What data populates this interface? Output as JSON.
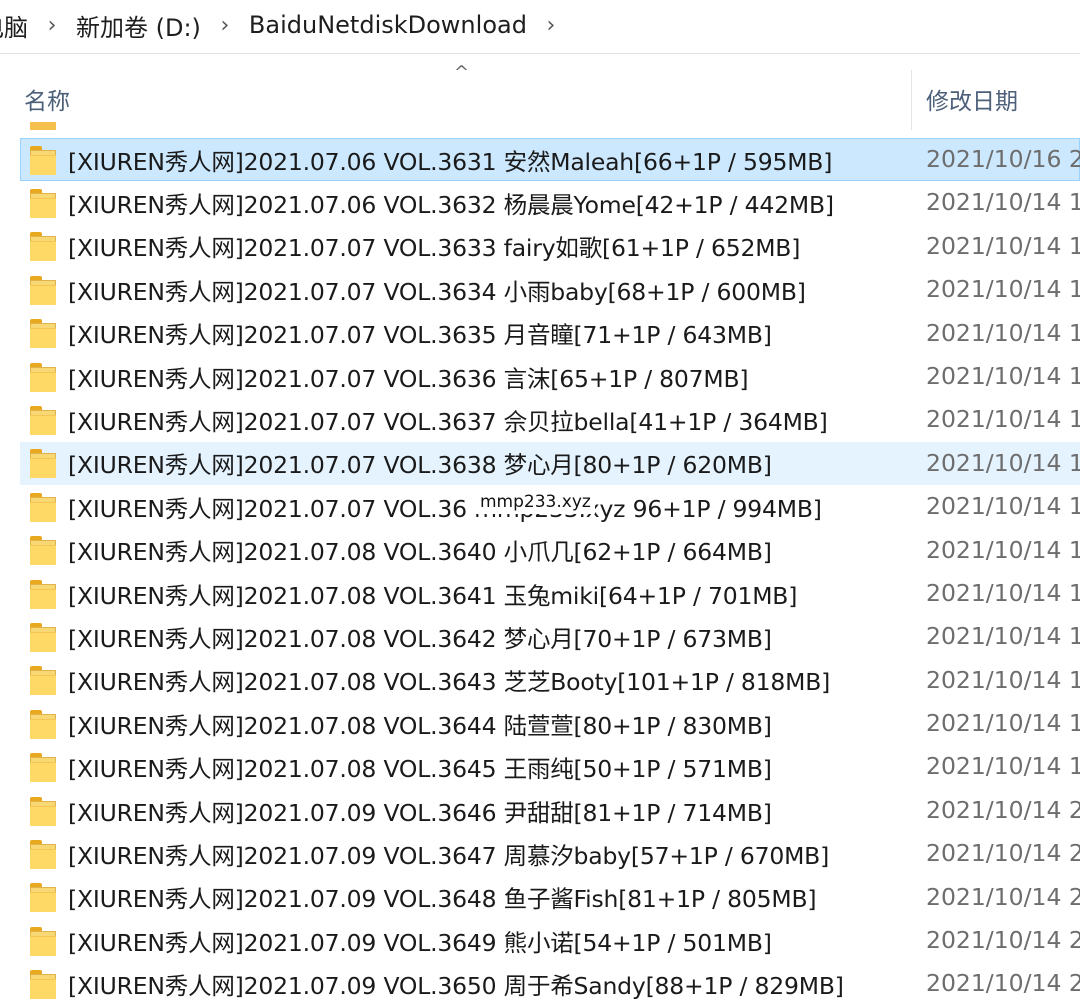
{
  "breadcrumb": {
    "items": [
      "电脑",
      "新加卷 (D:)",
      "BaiduNetdiskDownload"
    ],
    "separator": "›"
  },
  "columns": {
    "name": "名称",
    "date_modified": "修改日期",
    "sort_indicator": "^"
  },
  "files": [
    {
      "name": "[XIUREN秀人网]2021.07.06 VOL.3631 安然Maleah[66+1P / 595MB]",
      "date": "2021/10/16 2",
      "state": "selected"
    },
    {
      "name": "[XIUREN秀人网]2021.07.06 VOL.3632 杨晨晨Yome[42+1P / 442MB]",
      "date": "2021/10/14 1",
      "state": ""
    },
    {
      "name": "[XIUREN秀人网]2021.07.07 VOL.3633 fairy如歌[61+1P / 652MB]",
      "date": "2021/10/14 1",
      "state": ""
    },
    {
      "name": "[XIUREN秀人网]2021.07.07 VOL.3634 小雨baby[68+1P / 600MB]",
      "date": "2021/10/14 1",
      "state": ""
    },
    {
      "name": "[XIUREN秀人网]2021.07.07 VOL.3635 月音瞳[71+1P / 643MB]",
      "date": "2021/10/14 1",
      "state": ""
    },
    {
      "name": "[XIUREN秀人网]2021.07.07 VOL.3636 言沫[65+1P / 807MB]",
      "date": "2021/10/14 1",
      "state": ""
    },
    {
      "name": "[XIUREN秀人网]2021.07.07 VOL.3637 佘贝拉bella[41+1P / 364MB]",
      "date": "2021/10/14 1",
      "state": ""
    },
    {
      "name": "[XIUREN秀人网]2021.07.07 VOL.3638 梦心月[80+1P / 620MB]",
      "date": "2021/10/14 1",
      "state": "hover"
    },
    {
      "name": "[XIUREN秀人网]2021.07.07 VOL.36 mmp233.xyz 96+1P / 994MB]",
      "date": "2021/10/14 1",
      "state": ""
    },
    {
      "name": "[XIUREN秀人网]2021.07.08 VOL.3640 小爪几[62+1P / 664MB]",
      "date": "2021/10/14 1",
      "state": ""
    },
    {
      "name": "[XIUREN秀人网]2021.07.08 VOL.3641 玉兔miki[64+1P / 701MB]",
      "date": "2021/10/14 1",
      "state": ""
    },
    {
      "name": "[XIUREN秀人网]2021.07.08 VOL.3642 梦心月[70+1P / 673MB]",
      "date": "2021/10/14 1",
      "state": ""
    },
    {
      "name": "[XIUREN秀人网]2021.07.08 VOL.3643 芝芝Booty[101+1P / 818MB]",
      "date": "2021/10/14 1",
      "state": ""
    },
    {
      "name": "[XIUREN秀人网]2021.07.08 VOL.3644 陆萱萱[80+1P / 830MB]",
      "date": "2021/10/14 1",
      "state": ""
    },
    {
      "name": "[XIUREN秀人网]2021.07.08 VOL.3645 王雨纯[50+1P / 571MB]",
      "date": "2021/10/14 1",
      "state": ""
    },
    {
      "name": "[XIUREN秀人网]2021.07.09 VOL.3646 尹甜甜[81+1P / 714MB]",
      "date": "2021/10/14 2",
      "state": ""
    },
    {
      "name": "[XIUREN秀人网]2021.07.09 VOL.3647 周慕汐baby[57+1P / 670MB]",
      "date": "2021/10/14 2",
      "state": ""
    },
    {
      "name": "[XIUREN秀人网]2021.07.09 VOL.3648 鱼子酱Fish[81+1P / 805MB]",
      "date": "2021/10/14 2",
      "state": ""
    },
    {
      "name": "[XIUREN秀人网]2021.07.09 VOL.3649 熊小诺[54+1P / 501MB]",
      "date": "2021/10/14 2",
      "state": ""
    },
    {
      "name": "[XIUREN秀人网]2021.07.09 VOL.3650 周于希Sandy[88+1P / 829MB]",
      "date": "2021/10/14 2",
      "state": ""
    }
  ],
  "watermark": "mmp233.xyz",
  "colors": {
    "selected_bg": "#cce8ff",
    "hover_bg": "#e5f3ff",
    "folder": "#ffd966",
    "header_text": "#4c607a",
    "date_text": "#6d6d6d"
  }
}
